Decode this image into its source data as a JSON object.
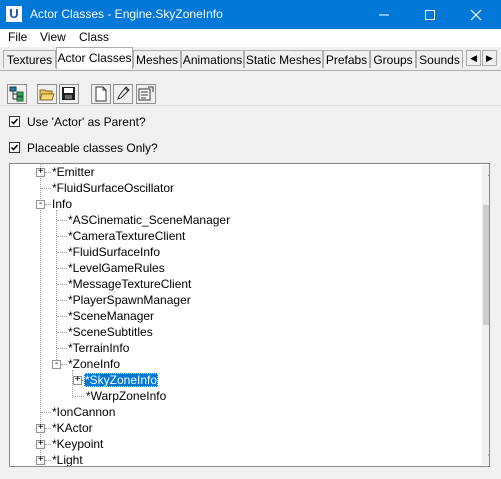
{
  "window": {
    "title": "Actor Classes - Engine.SkyZoneInfo",
    "app_icon_letter": "U",
    "accent_color": "#0078d7"
  },
  "menu": {
    "items": [
      {
        "label": "File"
      },
      {
        "label": "View"
      },
      {
        "label": "Class"
      }
    ]
  },
  "tabs": {
    "items": [
      {
        "label": "Textures",
        "active": false
      },
      {
        "label": "Actor Classes",
        "active": true
      },
      {
        "label": "Meshes",
        "active": false
      },
      {
        "label": "Animations",
        "active": false
      },
      {
        "label": "Static Meshes",
        "active": false
      },
      {
        "label": "Prefabs",
        "active": false
      },
      {
        "label": "Groups",
        "active": false
      },
      {
        "label": "Sounds",
        "active": false
      }
    ],
    "scroll_left": "◀",
    "scroll_right": "▶"
  },
  "toolbar": {
    "buttons": [
      "tree-view-icon",
      "open-folder-icon",
      "save-disk-icon",
      "new-document-icon",
      "edit-pencil-icon",
      "properties-icon"
    ]
  },
  "options": {
    "use_actor_parent": {
      "label": "Use 'Actor' as Parent?",
      "checked": true
    },
    "placeable_only": {
      "label": "Placeable classes Only?",
      "checked": true
    }
  },
  "tree": {
    "nodes": [
      {
        "label": "*Emitter",
        "expander": "+"
      },
      {
        "label": "*FluidSurfaceOscillator",
        "expander": ""
      },
      {
        "label": "Info",
        "expander": "-"
      },
      {
        "label": "*ASCinematic_SceneManager",
        "expander": ""
      },
      {
        "label": "*CameraTextureClient",
        "expander": ""
      },
      {
        "label": "*FluidSurfaceInfo",
        "expander": ""
      },
      {
        "label": "*LevelGameRules",
        "expander": ""
      },
      {
        "label": "*MessageTextureClient",
        "expander": ""
      },
      {
        "label": "*PlayerSpawnManager",
        "expander": ""
      },
      {
        "label": "*SceneManager",
        "expander": ""
      },
      {
        "label": "*SceneSubtitles",
        "expander": ""
      },
      {
        "label": "*TerrainInfo",
        "expander": ""
      },
      {
        "label": "*ZoneInfo",
        "expander": "-"
      },
      {
        "label": "*SkyZoneInfo",
        "expander": "+",
        "selected": true
      },
      {
        "label": "*WarpZoneInfo",
        "expander": ""
      },
      {
        "label": "*IonCannon",
        "expander": ""
      },
      {
        "label": "*KActor",
        "expander": "+"
      },
      {
        "label": "*Keypoint",
        "expander": "+"
      },
      {
        "label": "*Light",
        "expander": "+"
      }
    ]
  },
  "scrollbar": {
    "up_arrow": "▲",
    "down_arrow": "▼"
  }
}
